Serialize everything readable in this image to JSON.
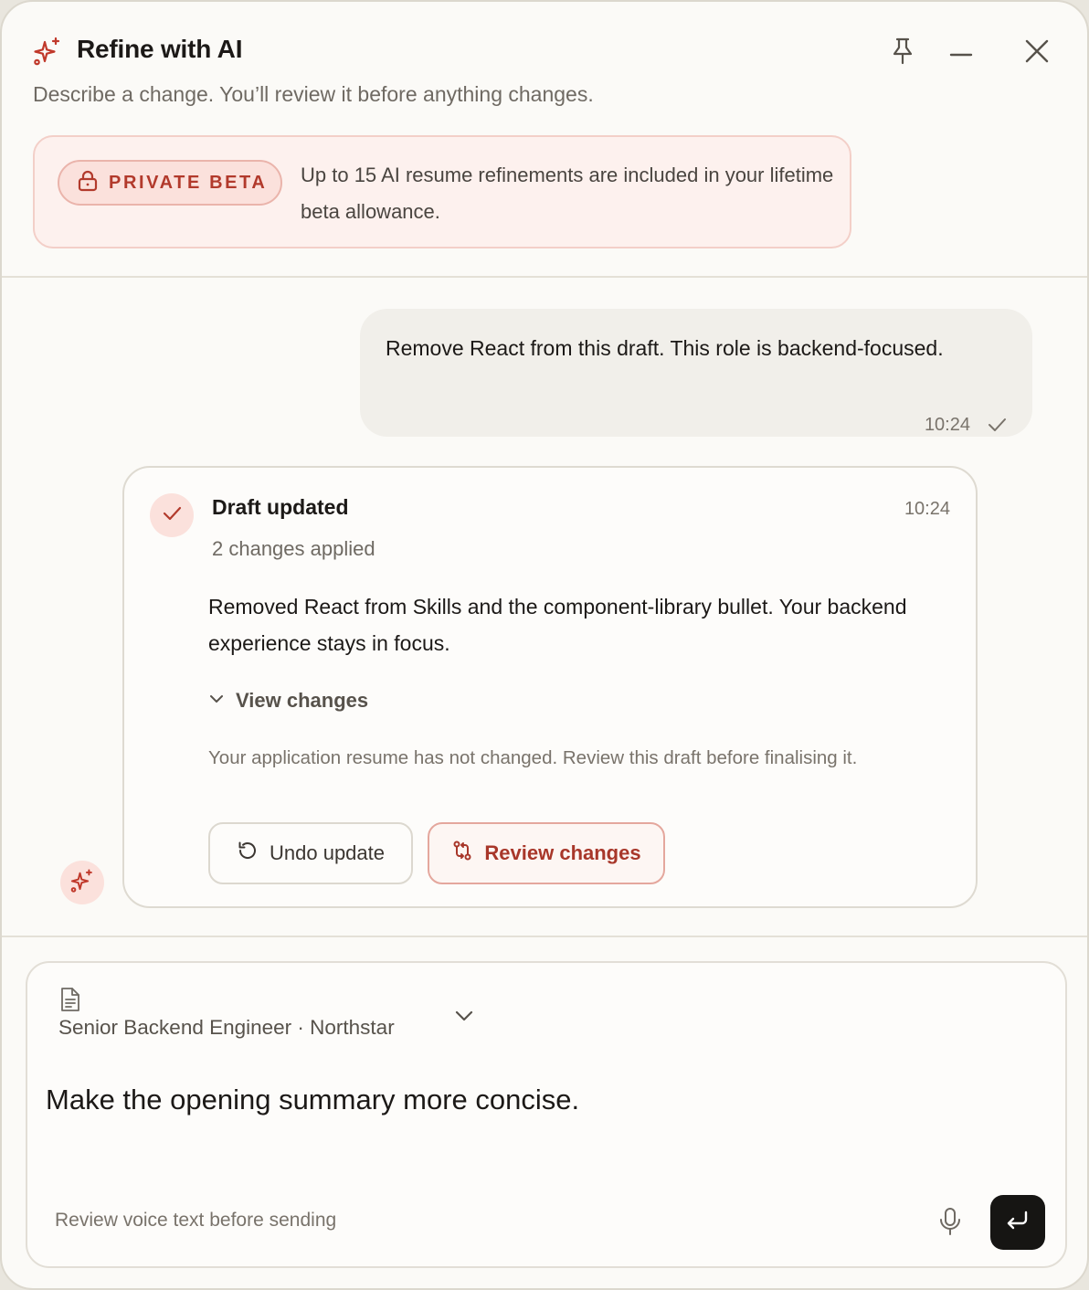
{
  "header": {
    "title": "Refine with AI",
    "subtitle": "Describe a change. You’ll review it before anything changes.",
    "icons": {
      "title": "sparkles-icon",
      "pin": "pin-icon",
      "minimize": "minimize-icon",
      "close": "close-icon"
    }
  },
  "beta": {
    "badge": "PRIVATE BETA",
    "badge_icon": "lock-icon",
    "text": "Up to 15 AI resume refinements are included in your lifetime beta allowance."
  },
  "conversation": {
    "user_message": {
      "text": "Remove React from this draft. This role is backend-focused.",
      "time": "10:24",
      "status_icon": "check-icon"
    },
    "ai_message": {
      "avatar_icon": "sparkles-icon",
      "status_icon": "check-icon",
      "title": "Draft updated",
      "time": "10:24",
      "subtitle": "2 changes applied",
      "body": "Removed React from Skills and the component-library bullet. Your backend experience stays in focus.",
      "view_changes": "View changes",
      "note": "Your application resume has not changed. Review this draft before finalising it.",
      "undo_label": "Undo update",
      "review_label": "Review changes"
    }
  },
  "composer": {
    "context_label": "Senior Backend Engineer · Northstar",
    "context_icon": "document-icon",
    "input_value": "Make the opening summary more concise.",
    "voice_hint": "Review voice text before sending",
    "mic_icon": "microphone-icon",
    "send_icon": "enter-icon"
  },
  "colors": {
    "accent": "#b23a2c",
    "panel_bg": "#fbfaf7",
    "send_bg": "#161513"
  }
}
